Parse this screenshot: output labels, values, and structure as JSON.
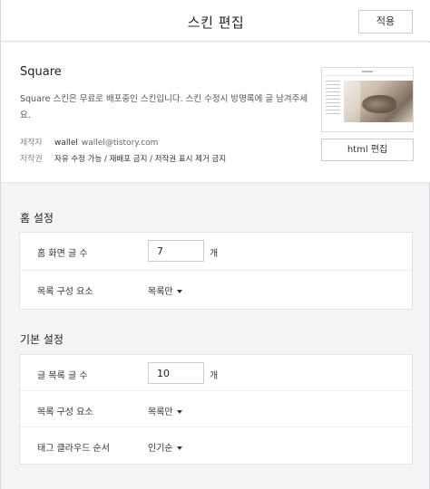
{
  "header": {
    "title": "스킨 편집",
    "apply_label": "적용"
  },
  "skin": {
    "name": "Square",
    "description": "Square 스킨은 무료로 배포중인 스킨입니다. 스킨 수정시 방명록에 글 남겨주세요.",
    "maker_label": "제작자",
    "maker_name": "wallel",
    "maker_email": "wallel@tistory.com",
    "copyright_label": "저작권",
    "copyright_text": "자유 수정 가능 / 재배포 금지 / 저작권 표시 제거 금지",
    "html_edit_label": "html 편집"
  },
  "home_settings": {
    "title": "홈 설정",
    "post_count_label": "홈 화면 글 수",
    "post_count_value": "7",
    "post_count_unit": "개",
    "list_component_label": "목록 구성 요소",
    "list_component_value": "목록만"
  },
  "basic_settings": {
    "title": "기본 설정",
    "list_post_count_label": "글 목록 글 수",
    "list_post_count_value": "10",
    "list_post_count_unit": "개",
    "list_component_label": "목록 구성 요소",
    "list_component_value": "목록만",
    "tag_cloud_order_label": "태그 클라우드 순서",
    "tag_cloud_order_value": "인기순"
  }
}
